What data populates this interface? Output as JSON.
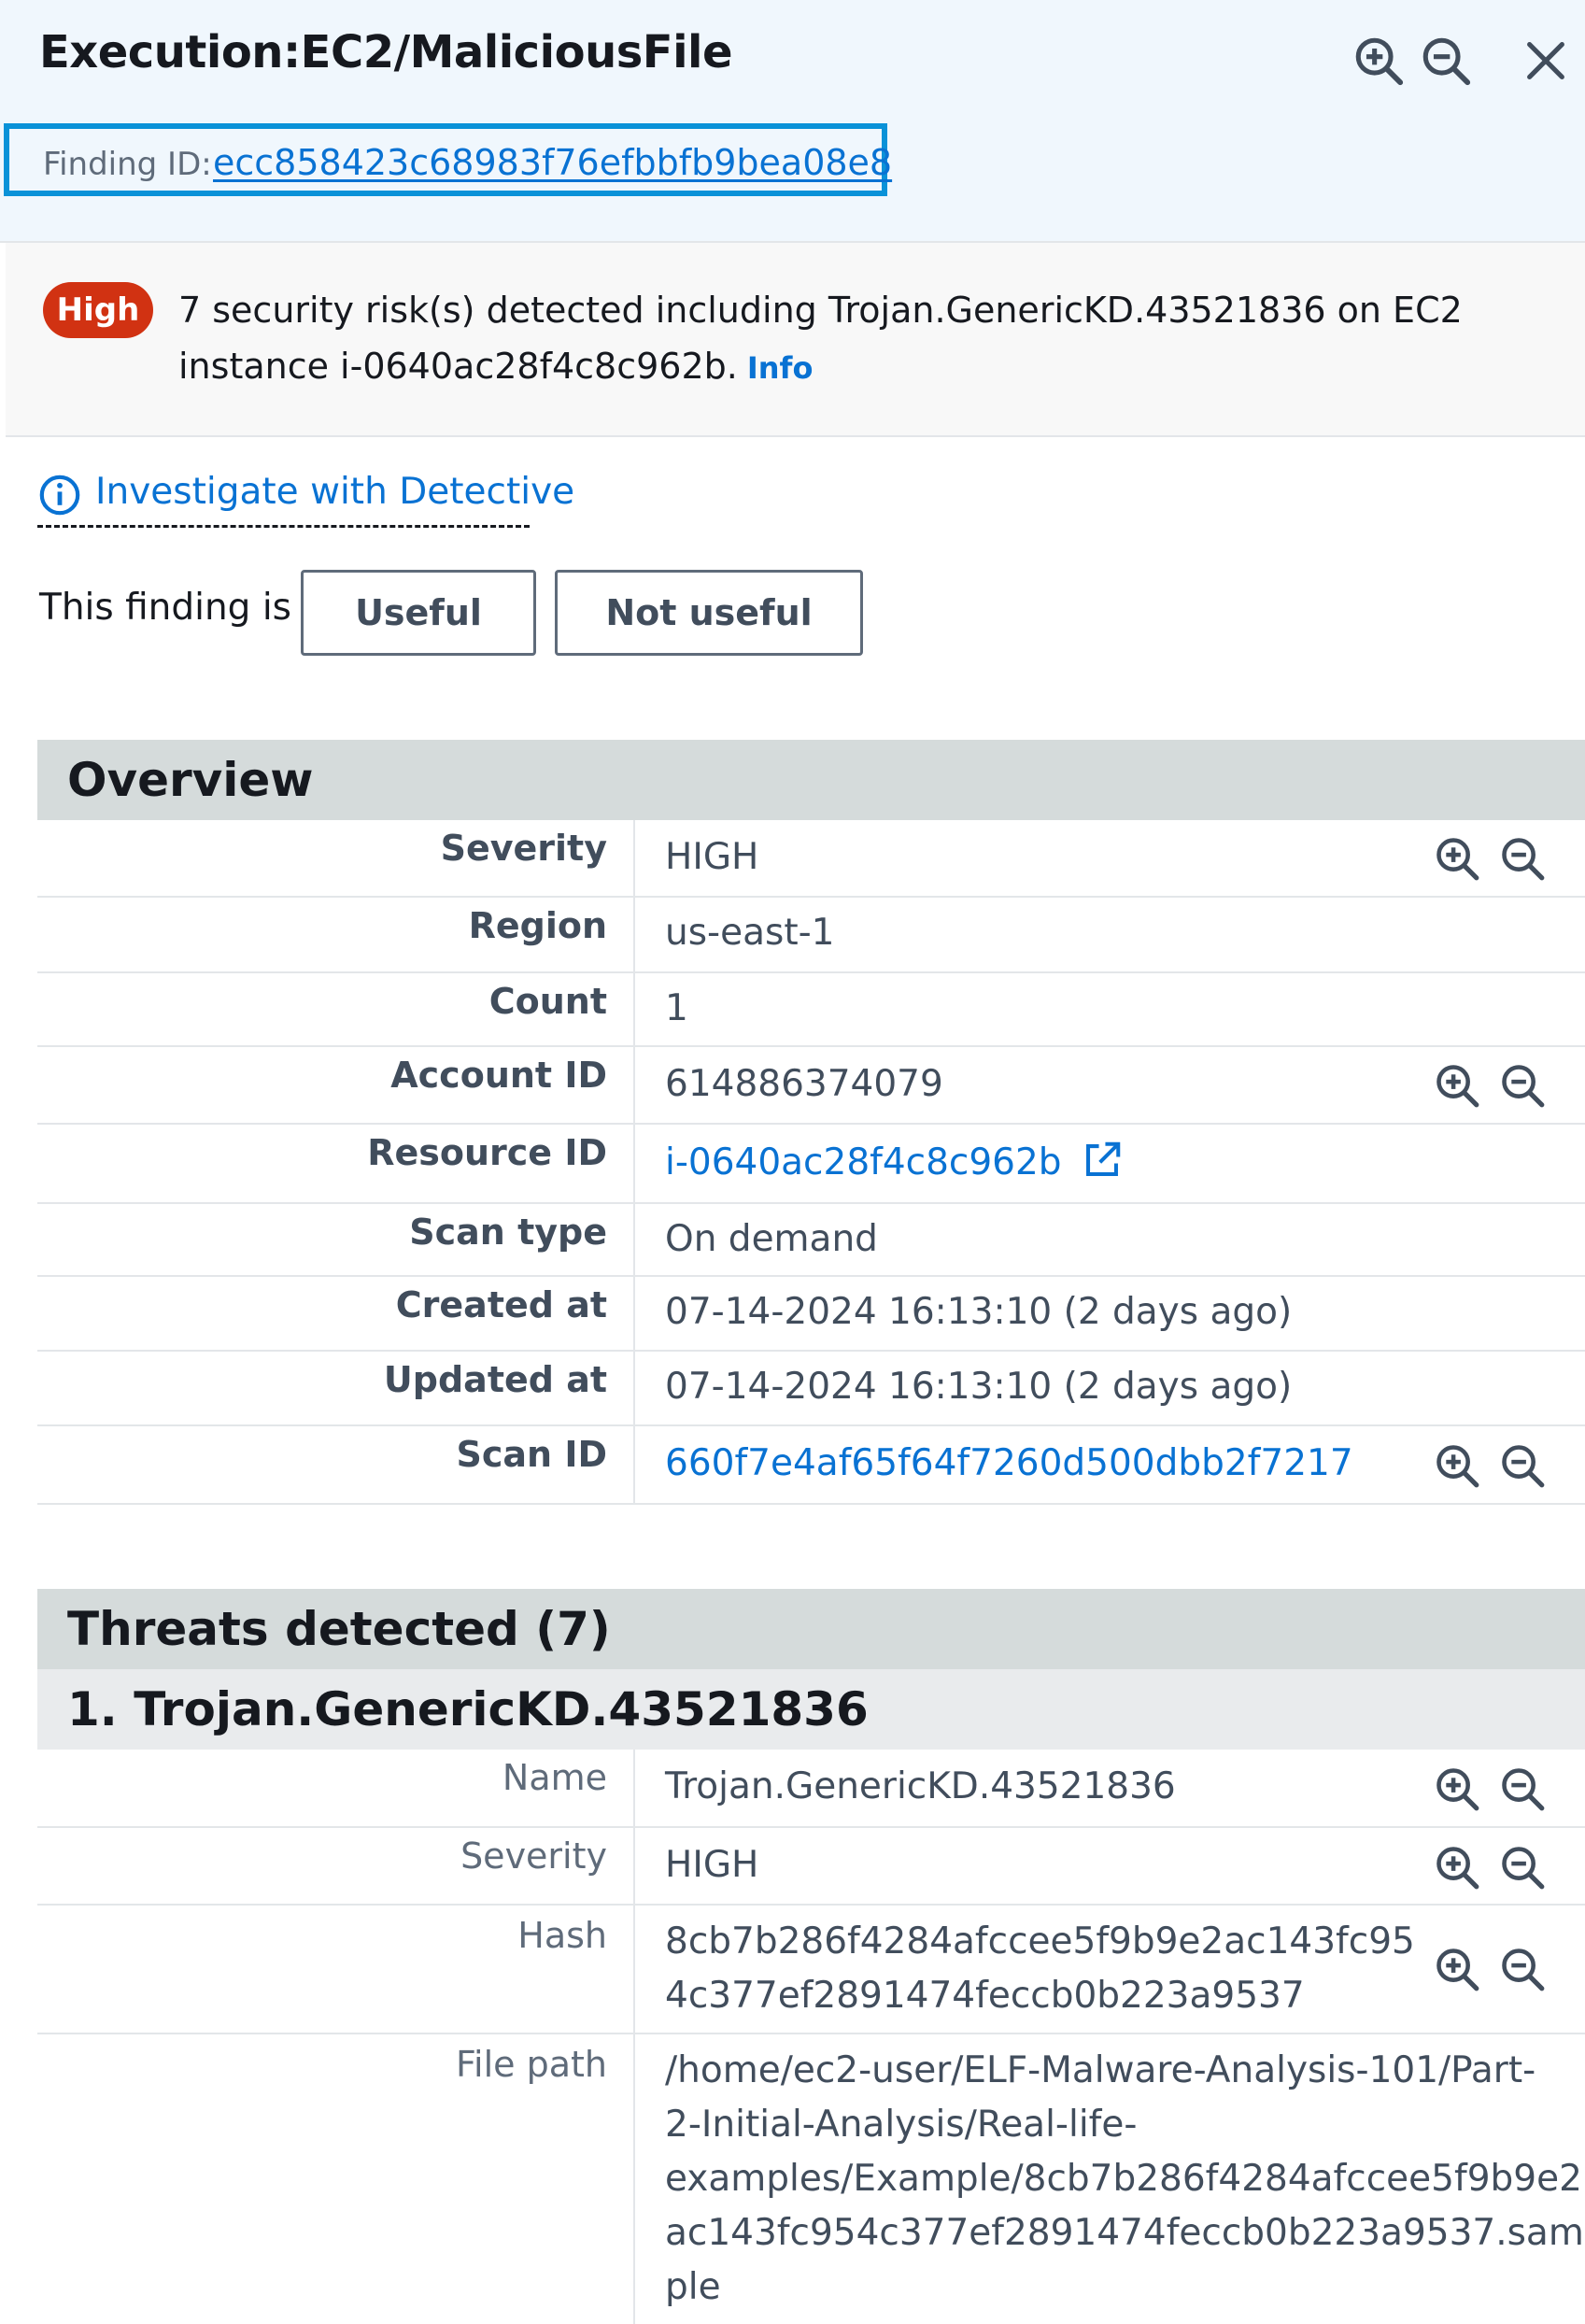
{
  "header": {
    "title": "Execution:EC2/MaliciousFile",
    "finding_id_label": "Finding ID:",
    "finding_id": "ecc858423c68983f76efbbfb9bea08e8"
  },
  "alert": {
    "severity_badge": "High",
    "message": "7 security risk(s) detected including Trojan.GenericKD.43521836 on EC2 instance i-0640ac28f4c8c962b.",
    "info_link": "Info"
  },
  "detective_link": "Investigate with Detective",
  "feedback": {
    "label": "This finding is",
    "useful": "Useful",
    "not_useful": "Not useful"
  },
  "overview": {
    "title": "Overview",
    "rows": [
      {
        "key": "Severity",
        "value": "HIGH"
      },
      {
        "key": "Region",
        "value": "us-east-1"
      },
      {
        "key": "Count",
        "value": "1"
      },
      {
        "key": "Account ID",
        "value": "614886374079"
      },
      {
        "key": "Resource ID",
        "value": "i-0640ac28f4c8c962b"
      },
      {
        "key": "Scan type",
        "value": "On demand"
      },
      {
        "key": "Created at",
        "value": "07-14-2024 16:13:10 (2 days ago)"
      },
      {
        "key": "Updated at",
        "value": "07-14-2024 16:13:10 (2 days ago)"
      },
      {
        "key": "Scan ID",
        "value": "660f7e4af65f64f7260d500dbb2f7217"
      }
    ]
  },
  "threats": {
    "title": "Threats detected (7)",
    "first_threat_title": "1. Trojan.GenericKD.43521836",
    "rows": [
      {
        "key": "Name",
        "value": "Trojan.GenericKD.43521836"
      },
      {
        "key": "Severity",
        "value": "HIGH"
      },
      {
        "key": "Hash",
        "value_line1": "8cb7b286f4284afccee5f9b9e2ac143fc95",
        "value_line2": "4c377ef2891474feccb0b223a9537"
      },
      {
        "key": "File path",
        "value_lines": [
          "/home/ec2-user/ELF-Malware-Analysis-101/Part-",
          "2-Initial-Analysis/Real-life-",
          "examples/Example/8cb7b286f4284afccee5f9b9e2",
          "ac143fc954c377ef2891474feccb0b223a9537.sam",
          "ple"
        ]
      }
    ]
  },
  "colors": {
    "accent_link": "#0972d3",
    "severity_high": "#d13212",
    "highlight_border": "#0a92d8",
    "header_bg": "#f0f7fd",
    "section_bg": "#d5dbdb"
  },
  "icons": [
    "zoom-in-icon",
    "zoom-out-icon",
    "close-icon",
    "info-circle-icon",
    "external-link-icon"
  ]
}
